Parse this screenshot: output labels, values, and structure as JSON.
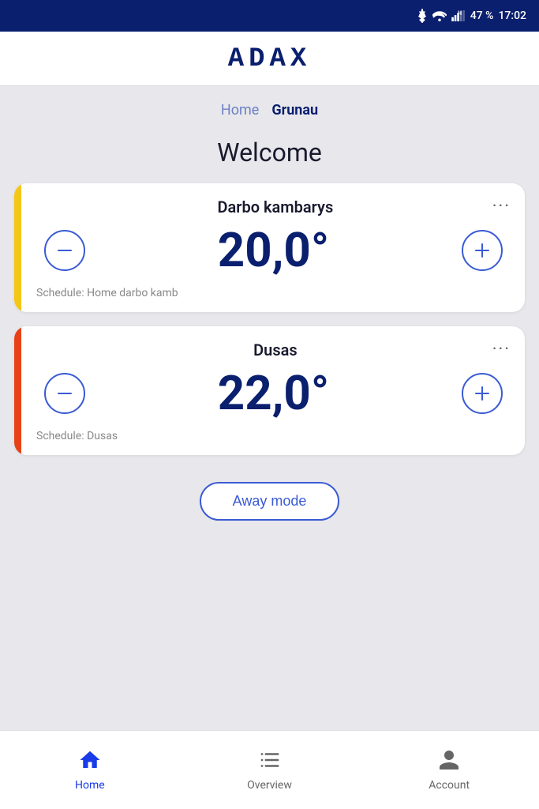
{
  "statusBar": {
    "battery": "47 %",
    "time": "17:02"
  },
  "header": {
    "logo": "ADAX"
  },
  "breadcrumb": {
    "home_label": "Home",
    "current_label": "Grunau"
  },
  "welcome": {
    "title": "Welcome"
  },
  "cards": [
    {
      "id": "card-1",
      "name": "Darbo kambarys",
      "temperature": "20,0°",
      "schedule": "Schedule: Home darbo kamb",
      "indicator_class": "yellow",
      "menu_icon": "···"
    },
    {
      "id": "card-2",
      "name": "Dusas",
      "temperature": "22,0°",
      "schedule": "Schedule: Dusas",
      "indicator_class": "orange",
      "menu_icon": "···"
    }
  ],
  "awayMode": {
    "label": "Away mode"
  },
  "bottomNav": {
    "items": [
      {
        "id": "home",
        "label": "Home",
        "active": true
      },
      {
        "id": "overview",
        "label": "Overview",
        "active": false
      },
      {
        "id": "account",
        "label": "Account",
        "active": false
      }
    ]
  }
}
